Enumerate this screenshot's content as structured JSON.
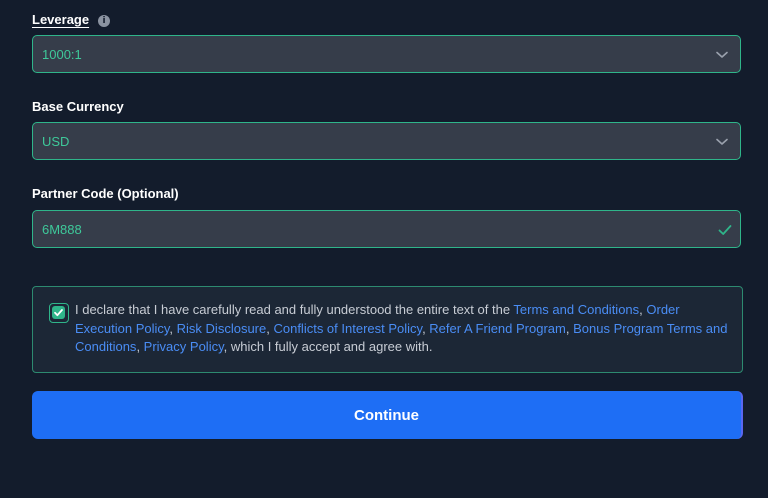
{
  "leverage": {
    "label": "Leverage",
    "info_icon": "info-icon",
    "value": "1000:1",
    "dropdown_icon": "chevron-down-icon"
  },
  "base_currency": {
    "label": "Base Currency",
    "value": "USD",
    "dropdown_icon": "chevron-down-icon"
  },
  "partner_code": {
    "label": "Partner Code (Optional)",
    "value": "6M888",
    "status_icon": "check-icon"
  },
  "declaration": {
    "checked": true,
    "text_intro": "I declare that I have carefully read and fully understood the entire text of the ",
    "links": {
      "terms": "Terms and Conditions",
      "order_execution": "Order Execution Policy",
      "risk_disclosure": "Risk Disclosure",
      "conflicts": "Conflicts of Interest Policy",
      "refer_friend": "Refer A Friend Program",
      "bonus_terms": "Bonus Program Terms and Conditions",
      "privacy": "Privacy Policy"
    },
    "separator": ", ",
    "text_outro": ", which I fully accept and agree with."
  },
  "continue_label": "Continue",
  "colors": {
    "background": "#131c2c",
    "accent_green": "#2fb58a",
    "link_blue": "#4a8df5",
    "button_blue": "#1e6ef5"
  }
}
